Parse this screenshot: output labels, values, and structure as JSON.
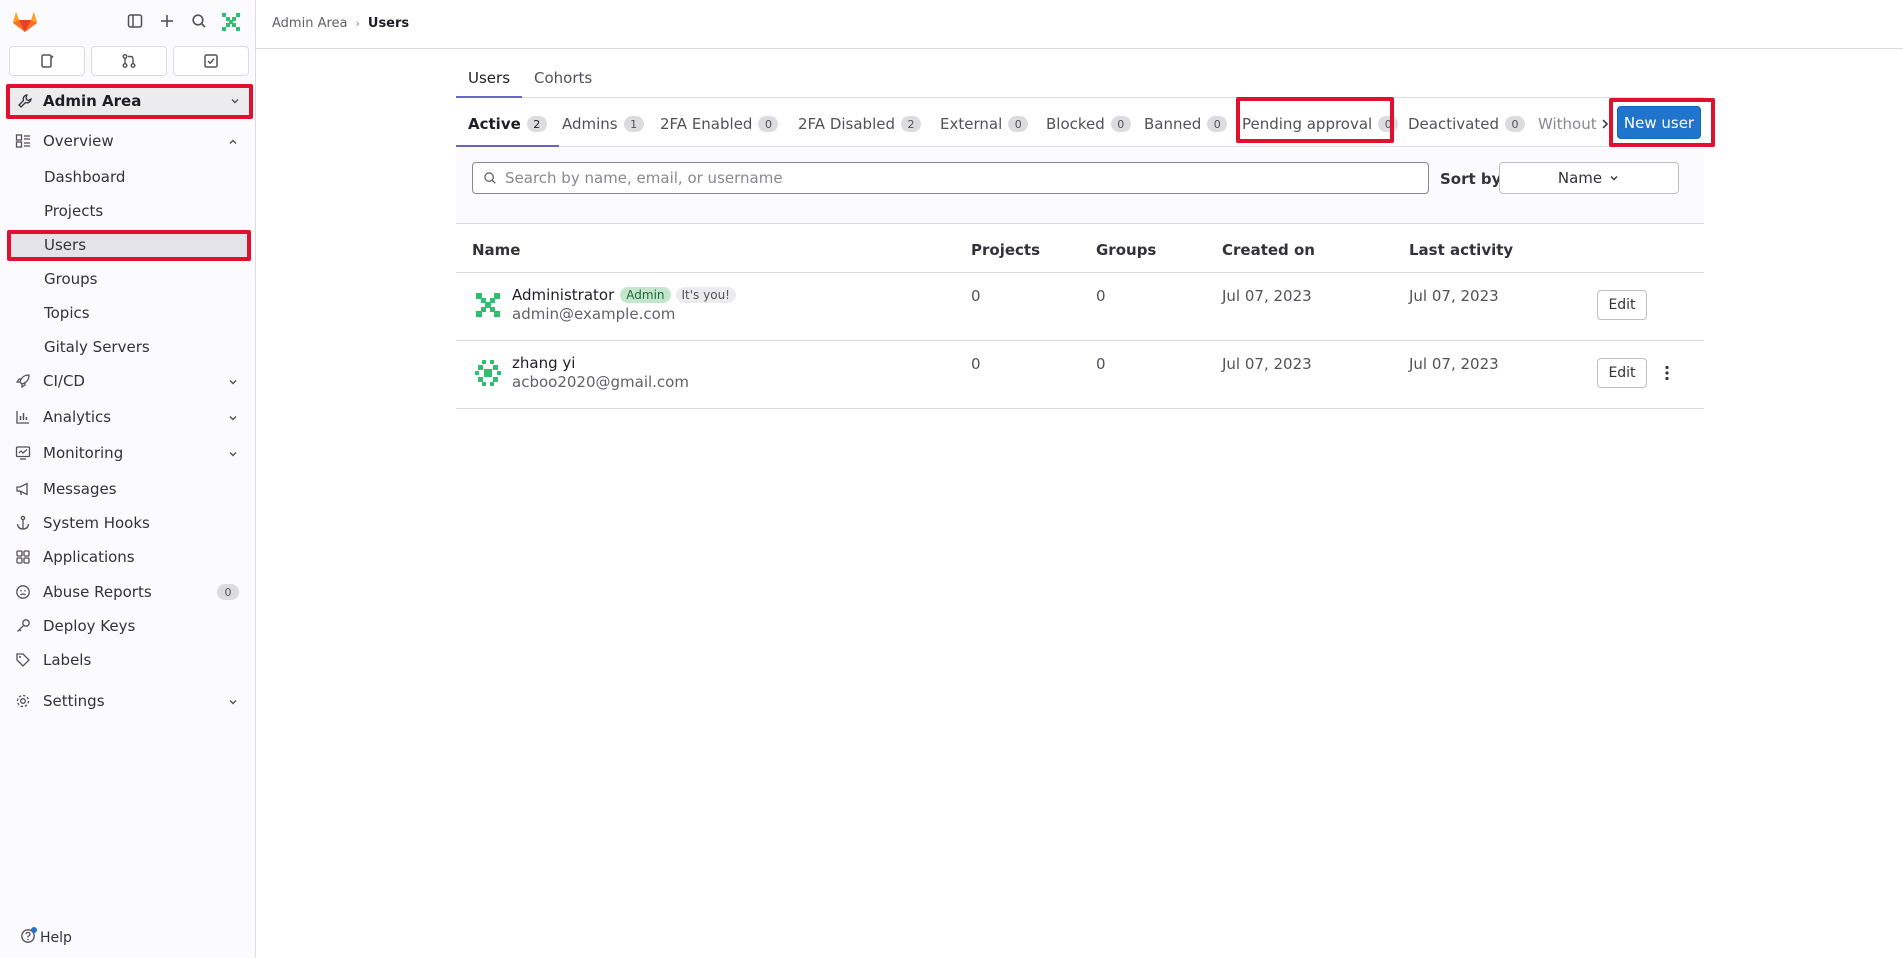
{
  "sidebar": {
    "context_title": "Admin Area",
    "nav": {
      "overview": "Overview",
      "overview_items": [
        "Dashboard",
        "Projects",
        "Users",
        "Groups",
        "Topics",
        "Gitaly Servers"
      ],
      "cicd": "CI/CD",
      "analytics": "Analytics",
      "monitoring": "Monitoring",
      "messages": "Messages",
      "system_hooks": "System Hooks",
      "applications": "Applications",
      "abuse_reports": "Abuse Reports",
      "abuse_reports_count": "0",
      "deploy_keys": "Deploy Keys",
      "labels": "Labels",
      "settings": "Settings"
    },
    "help": "Help"
  },
  "breadcrumb": {
    "parent": "Admin Area",
    "current": "Users"
  },
  "main_tabs": [
    "Users",
    "Cohorts"
  ],
  "filter_tabs": [
    {
      "label": "Active",
      "count": "2"
    },
    {
      "label": "Admins",
      "count": "1"
    },
    {
      "label": "2FA Enabled",
      "count": "0"
    },
    {
      "label": "2FA Disabled",
      "count": "2"
    },
    {
      "label": "External",
      "count": "0"
    },
    {
      "label": "Blocked",
      "count": "0"
    },
    {
      "label": "Banned",
      "count": "0"
    },
    {
      "label": "Pending approval",
      "count": "0"
    },
    {
      "label": "Deactivated",
      "count": "0"
    },
    {
      "label": "Without"
    }
  ],
  "new_user_button": "New user",
  "search": {
    "placeholder": "Search by name, email, or username"
  },
  "sort": {
    "label": "Sort by",
    "selected": "Name"
  },
  "table": {
    "columns": [
      "Name",
      "Projects",
      "Groups",
      "Created on",
      "Last activity"
    ],
    "rows": [
      {
        "name": "Administrator",
        "badges": [
          "Admin",
          "It's you!"
        ],
        "email": "admin@example.com",
        "projects": "0",
        "groups": "0",
        "created_on": "Jul 07, 2023",
        "last_activity": "Jul 07, 2023",
        "edit": "Edit"
      },
      {
        "name": "zhang yi",
        "email": "acboo2020@gmail.com",
        "projects": "0",
        "groups": "0",
        "created_on": "Jul 07, 2023",
        "last_activity": "Jul 07, 2023",
        "edit": "Edit"
      }
    ]
  },
  "colors": {
    "accent": "#1f75cb",
    "tab_underline": "#6666c4",
    "highlight": "#e0102e",
    "admin_badge": "#c3e6cd"
  }
}
